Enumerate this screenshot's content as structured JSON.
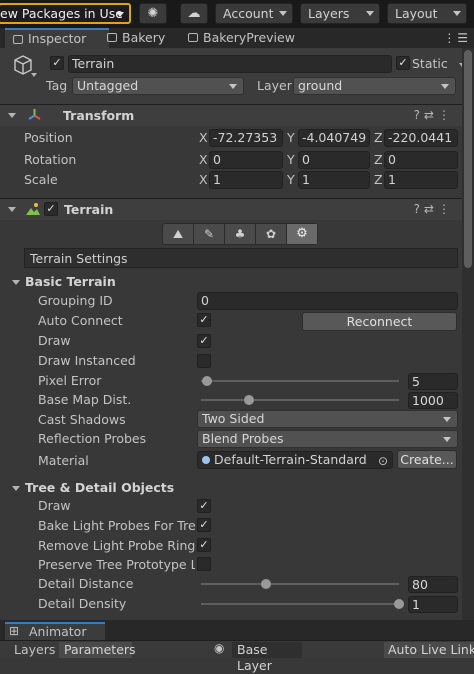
{
  "toolbar": {
    "packages_label": "ew Packages in Use",
    "account_label": "Account",
    "layers_label": "Layers",
    "layout_label": "Layout",
    "icons": [
      "collab-icon",
      "cloud-icon"
    ]
  },
  "tabs": [
    {
      "label": "Inspector",
      "active": true
    },
    {
      "label": "Bakery",
      "active": false
    },
    {
      "label": "BakeryPreview",
      "active": false
    }
  ],
  "object": {
    "name": "Terrain",
    "active": true,
    "static_label": "Static",
    "tag_label": "Tag",
    "tag_value": "Untagged",
    "layer_label": "Layer",
    "layer_value": "ground"
  },
  "transform": {
    "title": "Transform",
    "position_label": "Position",
    "rotation_label": "Rotation",
    "scale_label": "Scale",
    "axis_x": "X",
    "axis_y": "Y",
    "axis_z": "Z",
    "position": [
      "-72.27353",
      "-4.040749",
      "-220.0441"
    ],
    "rotation": [
      "0",
      "0",
      "0"
    ],
    "scale": [
      "1",
      "1",
      "1"
    ]
  },
  "terrain": {
    "title": "Terrain",
    "settings_label": "Terrain Settings",
    "basic_title": "Basic Terrain",
    "grouping_id_label": "Grouping ID",
    "grouping_id_value": "0",
    "auto_connect_label": "Auto Connect",
    "reconnect_label": "Reconnect",
    "draw_label": "Draw",
    "draw_instanced_label": "Draw Instanced",
    "pixel_error_label": "Pixel Error",
    "pixel_error_value": "5",
    "pixel_error_fraction": 0.03,
    "base_map_label": "Base Map Dist.",
    "base_map_value": "1000",
    "base_map_fraction": 0.24,
    "cast_shadows_label": "Cast Shadows",
    "cast_shadows_value": "Two Sided",
    "reflection_probes_label": "Reflection Probes",
    "reflection_probes_value": "Blend Probes",
    "material_label": "Material",
    "material_value": "Default-Terrain-Standard",
    "create_label": "Create...",
    "tree_title": "Tree & Detail Objects",
    "tree_draw_label": "Draw",
    "bake_probes_label": "Bake Light Probes For Trees",
    "remove_ringing_label": "Remove Light Probe Ringing",
    "preserve_proto_label": "Preserve Tree Prototype Layers",
    "detail_distance_label": "Detail Distance",
    "detail_distance_value": "80",
    "detail_distance_fraction": 0.33,
    "detail_density_label": "Detail Density",
    "detail_density_value": "1",
    "detail_density_fraction": 1.0
  },
  "bottom": {
    "animator_label": "Animator",
    "layers_tab": "Layers",
    "parameters_tab": "Parameters",
    "base_layer_label": "Base Layer",
    "live_link_label": "Auto Live Link"
  }
}
